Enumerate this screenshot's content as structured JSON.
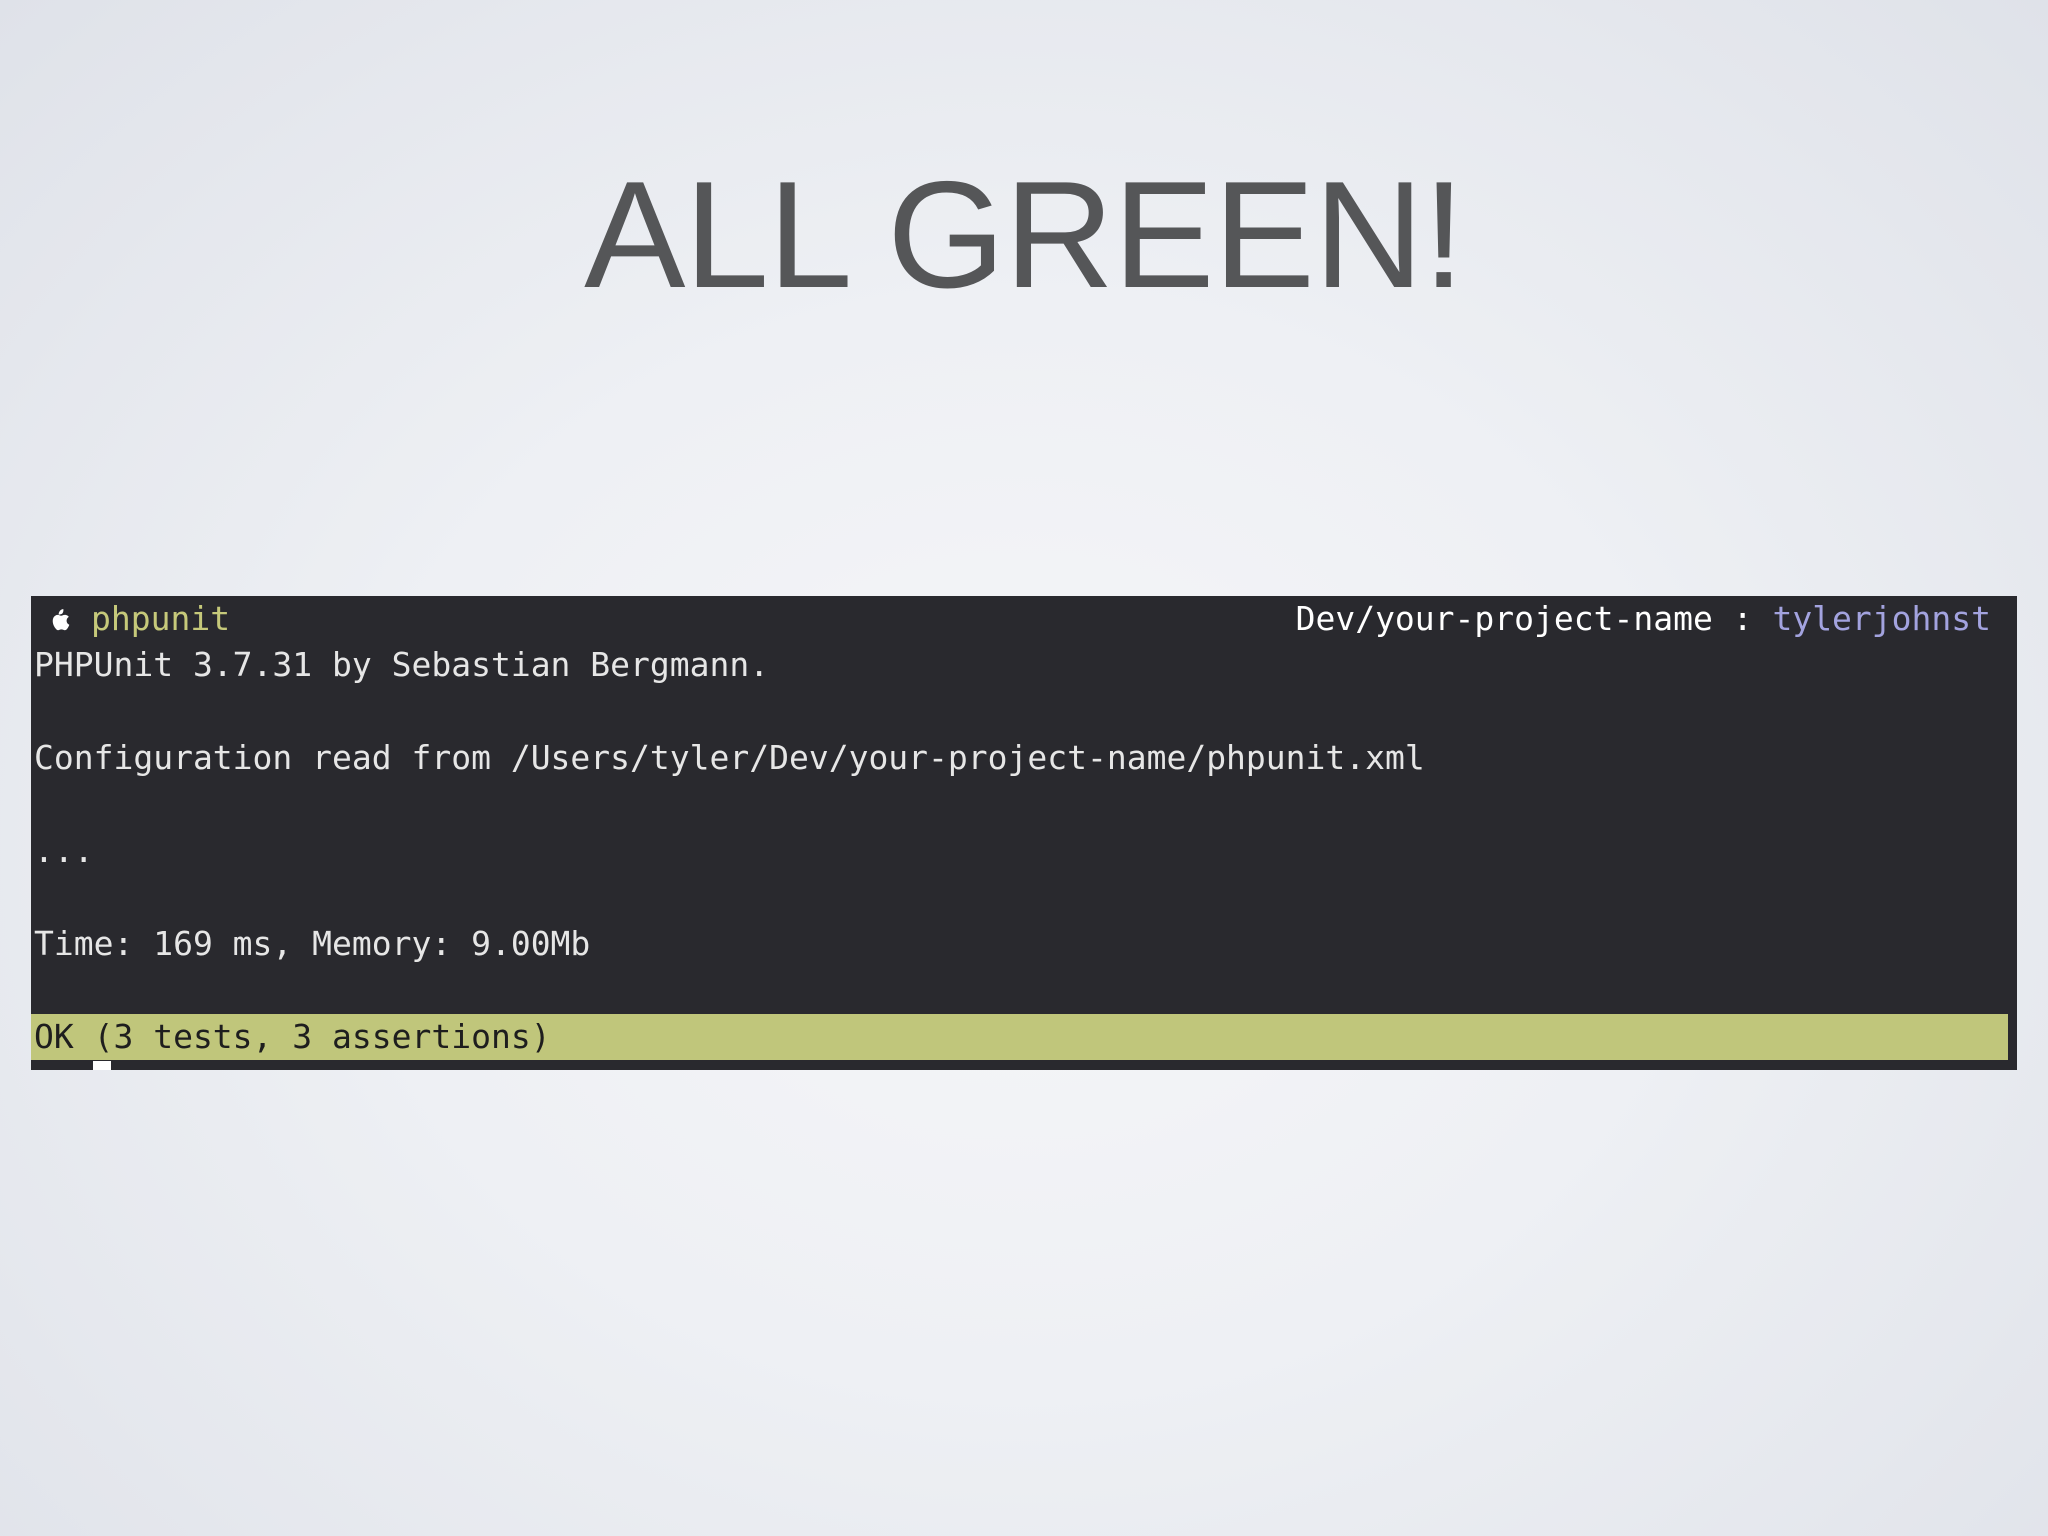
{
  "slide": {
    "title": "ALL GREEN!"
  },
  "terminal": {
    "prompt": {
      "icon": "apple-icon",
      "command": "phpunit",
      "path": "Dev/your-project-name",
      "separator": ":",
      "user": "tylerjohnst"
    },
    "lines": {
      "version": "PHPUnit 3.7.31 by Sebastian Bergmann.",
      "config": "Configuration read from /Users/tyler/Dev/your-project-name/phpunit.xml",
      "progress": "...",
      "time": "Time: 169 ms, Memory: 9.00Mb"
    },
    "result": "OK (3 tests, 3 assertions)",
    "colors": {
      "background": "#29292e",
      "text": "#e6e6e6",
      "command": "#c6c97a",
      "user": "#a3a3df",
      "ok_bar": "#c0c67b"
    }
  }
}
